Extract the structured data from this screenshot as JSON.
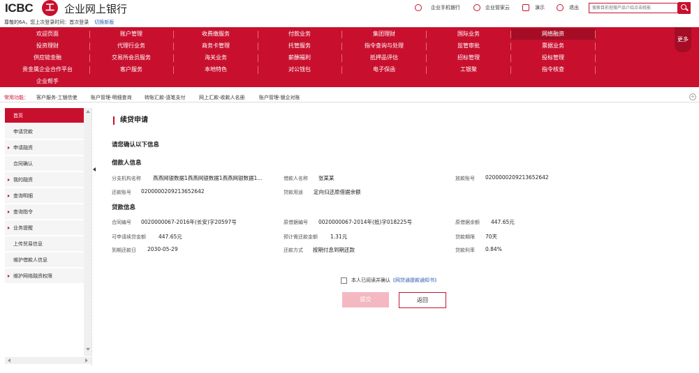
{
  "header": {
    "logo_text": "ICBC",
    "logo_mark": "工",
    "bank_name": "企业网上银行",
    "welcome": "尊敬的6A，您上次登录时间：首次登录",
    "switch_link": "切换新版",
    "links": [
      {
        "label": "企业手机银行",
        "icon": "mobile-bank-icon"
      },
      {
        "label": "企业管家云",
        "icon": "cloud-icon"
      },
      {
        "label": "演示",
        "icon": "demo-icon"
      },
      {
        "label": "退出",
        "icon": "power-icon"
      }
    ],
    "search_placeholder": "搜索目前捏搜产品介绍点击就能",
    "search_icon": "search-icon",
    "accent_color": "#c8102e"
  },
  "nav": {
    "rows": [
      [
        "欢迎页面",
        "账户管理",
        "收费缴服务",
        "付款业务",
        "集团理财",
        "国际业务",
        "网络融资"
      ],
      [
        "投资理财",
        "代理行业务",
        "商务卡管理",
        "托管服务",
        "指令查询与处理",
        "监管审批",
        "票据业务"
      ],
      [
        "供应链金融",
        "交易所会员服务",
        "海关业务",
        "薪酬福利",
        "抵押品评估",
        "招标管理",
        "投标管理"
      ],
      [
        "贵金属企业合作平台",
        "客户服务",
        "本地特色",
        "对公钱包",
        "电子保函",
        "工银聚",
        "指令核查"
      ],
      [
        "企业帮手"
      ]
    ],
    "active": "网络融资",
    "more": "更多"
  },
  "common": {
    "label": "常用功能：",
    "items": [
      "客户服务-工银信使",
      "账户管理-明细查询",
      "转账汇款-逐笔支付",
      "网上汇款-收款人名册",
      "账户管理-银企对账"
    ]
  },
  "sidebar": {
    "items": [
      {
        "label": "首页",
        "active": true,
        "arrow": false
      },
      {
        "label": "申请贷款",
        "active": false,
        "arrow": false
      },
      {
        "label": "申请融资",
        "active": false,
        "arrow": true
      },
      {
        "label": "合同确认",
        "active": false,
        "arrow": false
      },
      {
        "label": "我的融资",
        "active": false,
        "arrow": true
      },
      {
        "label": "查询明细",
        "active": false,
        "arrow": true
      },
      {
        "label": "查询指令",
        "active": false,
        "arrow": true
      },
      {
        "label": "业务提醒",
        "active": false,
        "arrow": true
      },
      {
        "label": "上传贸易信息",
        "active": false,
        "arrow": false
      },
      {
        "label": "维护借款人信息",
        "active": false,
        "arrow": false
      },
      {
        "label": "维护网络融资权限",
        "active": false,
        "arrow": true
      }
    ]
  },
  "main": {
    "title": "续贷申请",
    "confirm": "请您确认以下信息",
    "borrower_section": "借款人信息",
    "borrower": {
      "branch_label": "分支机构名称",
      "branch_value": "燕燕网银数据1燕燕网银数据1燕燕网银数据1...",
      "name_label": "借款人名称",
      "name_value": "张某某",
      "disburse_label": "放款账号",
      "disburse_value": "0200000209213652642",
      "repay_label": "还款账号",
      "repay_value": "0200000209213652642",
      "purpose_label": "贷款用途",
      "purpose_value": "定向归还原借据余额"
    },
    "loan_section": "贷款信息",
    "loan": {
      "contract_label": "合同编号",
      "contract_value": "0020000067-2016年(长安)字20597号",
      "orig_label": "原借据编号",
      "orig_value": "0020000067-2014年(抵)字018225号",
      "balance_label": "原借据余额",
      "balance_value": "447.65元",
      "avail_label": "可申请续贷金额",
      "avail_value": "447.65元",
      "est_label": "预计需还款金额",
      "est_value": "1.31元",
      "term_label": "贷款期限",
      "term_value": "70天",
      "due_label": "到期还款日",
      "due_value": "2030-05-29",
      "method_label": "还款方式",
      "method_value": "按期付息到期还款",
      "rate_label": "贷款利率",
      "rate_value": "0.84%"
    },
    "agree_text": "本人已阅读并确认",
    "agree_link": "《网贷通提款通知书》",
    "submit": "提交",
    "back": "返回"
  }
}
